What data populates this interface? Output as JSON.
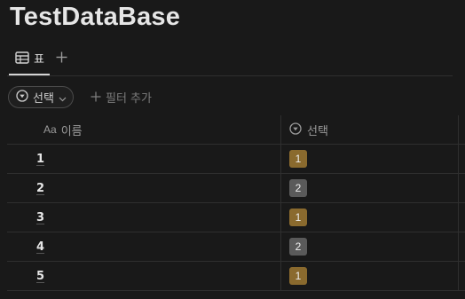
{
  "database": {
    "title": "TestDataBase"
  },
  "views": {
    "active_tab": {
      "label": "표",
      "icon": "table-icon"
    },
    "add_view": {
      "icon": "plus-icon"
    }
  },
  "filters": {
    "chip": {
      "label": "선택",
      "icon": "select-property-icon",
      "chevron": "chevron-down-icon"
    },
    "add_filter": {
      "label": "필터 추가",
      "icon": "plus-icon"
    }
  },
  "table": {
    "columns": [
      {
        "label": "이름",
        "icon": "Aa"
      },
      {
        "label": "선택",
        "icon": "select-property-icon"
      }
    ],
    "rows": [
      {
        "name": "1",
        "tag": "1",
        "tag_color": "#8a6a2e"
      },
      {
        "name": "2",
        "tag": "2",
        "tag_color": "#5a5a5a"
      },
      {
        "name": "3",
        "tag": "1",
        "tag_color": "#8a6a2e"
      },
      {
        "name": "4",
        "tag": "2",
        "tag_color": "#5a5a5a"
      },
      {
        "name": "5",
        "tag": "1",
        "tag_color": "#8a6a2e"
      }
    ]
  },
  "colors": {
    "background": "#191919",
    "tag_option_1": "#8a6a2e",
    "tag_option_2": "#5a5a5a"
  }
}
